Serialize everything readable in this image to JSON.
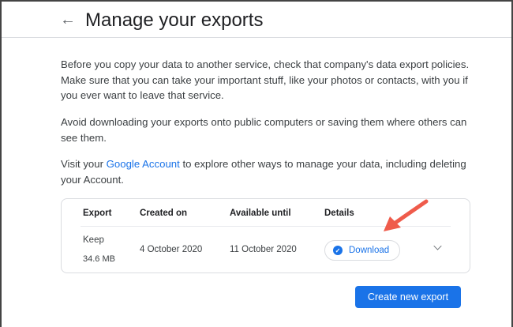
{
  "header": {
    "title": "Manage your exports",
    "back_icon": "arrow-left-icon"
  },
  "intro": {
    "p1": "Before you copy your data to another service, check that company's data export policies. Make sure that you can take your important stuff, like your photos or contacts, with you if you ever want to leave that service.",
    "p2": "Avoid downloading your exports onto public computers or saving them where others can see them.",
    "p3_before": "Visit your ",
    "p3_link": "Google Account",
    "p3_after": " to explore other ways to manage your data, including deleting your Account."
  },
  "table": {
    "headers": [
      "Export",
      "Created on",
      "Available until",
      "Details"
    ],
    "rows": [
      {
        "name": "Keep",
        "size": "34.6 MB",
        "created": "4 October 2020",
        "available_until": "11 October 2020",
        "action": "Download"
      }
    ]
  },
  "create_button": "Create new export",
  "colors": {
    "accent": "#1a73e8",
    "annotation_arrow": "#ef5b4b"
  }
}
